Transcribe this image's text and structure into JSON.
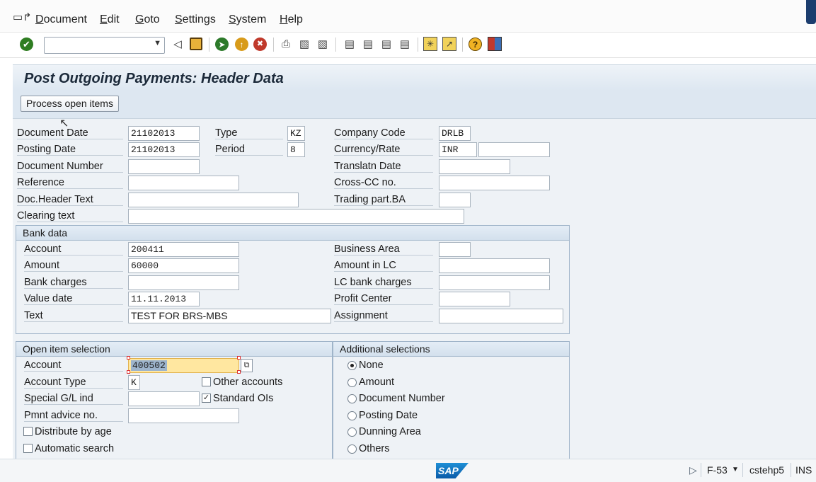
{
  "menu": {
    "items": [
      "Document",
      "Edit",
      "Goto",
      "Settings",
      "System",
      "Help"
    ]
  },
  "toolbar": {
    "command_field_value": "",
    "icons": [
      "enter-icon",
      "back-arrow-icon",
      "save-icon",
      "back-icon",
      "exit-icon",
      "cancel-icon",
      "print-icon",
      "find-icon",
      "find-next-icon",
      "first-page-icon",
      "previous-page-icon",
      "next-page-icon",
      "last-page-icon",
      "new-session-icon",
      "shortcut-icon",
      "help-icon",
      "customize-layout-icon"
    ]
  },
  "title": "Post Outgoing Payments: Header Data",
  "app_toolbar": {
    "process_open_items": "Process open items"
  },
  "header": {
    "document_date": {
      "label": "Document Date",
      "value": "21102013"
    },
    "type": {
      "label": "Type",
      "value": "KZ"
    },
    "company_code": {
      "label": "Company Code",
      "value": "DRLB"
    },
    "posting_date": {
      "label": "Posting Date",
      "value": "21102013"
    },
    "period": {
      "label": "Period",
      "value": "8"
    },
    "currency_rate": {
      "label": "Currency/Rate",
      "value": "INR",
      "rate": ""
    },
    "document_number": {
      "label": "Document Number",
      "value": ""
    },
    "translatn_date": {
      "label": "Translatn Date",
      "value": ""
    },
    "reference": {
      "label": "Reference",
      "value": ""
    },
    "cross_cc": {
      "label": "Cross-CC no.",
      "value": ""
    },
    "doc_header_text": {
      "label": "Doc.Header Text",
      "value": ""
    },
    "trading_part": {
      "label": "Trading part.BA",
      "value": ""
    },
    "clearing_text": {
      "label": "Clearing text",
      "value": ""
    }
  },
  "bank_data": {
    "title": "Bank data",
    "account": {
      "label": "Account",
      "value": "200411"
    },
    "business_area": {
      "label": "Business Area",
      "value": ""
    },
    "amount": {
      "label": "Amount",
      "value": "60000"
    },
    "amount_lc": {
      "label": "Amount in LC",
      "value": ""
    },
    "bank_charges": {
      "label": "Bank charges",
      "value": ""
    },
    "lc_bank_charges": {
      "label": "LC bank charges",
      "value": ""
    },
    "value_date": {
      "label": "Value date",
      "value": "11.11.2013"
    },
    "profit_center": {
      "label": "Profit Center",
      "value": ""
    },
    "text": {
      "label": "Text",
      "value": "TEST FOR BRS-MBS"
    },
    "assignment": {
      "label": "Assignment",
      "value": ""
    }
  },
  "open_item_selection": {
    "title": "Open item selection",
    "account": {
      "label": "Account",
      "value": "400502"
    },
    "account_type": {
      "label": "Account Type",
      "value": "K"
    },
    "other_accounts": {
      "label": "Other accounts",
      "checked": false
    },
    "special_gl": {
      "label": "Special G/L ind",
      "value": ""
    },
    "standard_ois": {
      "label": "Standard OIs",
      "checked": true
    },
    "pmnt_advice": {
      "label": "Pmnt advice no.",
      "value": ""
    },
    "distribute_by_age": {
      "label": "Distribute by age",
      "checked": false
    },
    "automatic_search": {
      "label": "Automatic search",
      "checked": false
    }
  },
  "additional_selections": {
    "title": "Additional selections",
    "options": [
      "None",
      "Amount",
      "Document Number",
      "Posting Date",
      "Dunning Area",
      "Others"
    ],
    "selected": "None"
  },
  "status": {
    "logo": "SAP",
    "transaction": "F-53",
    "server": "cstehp5",
    "mode": "INS"
  }
}
